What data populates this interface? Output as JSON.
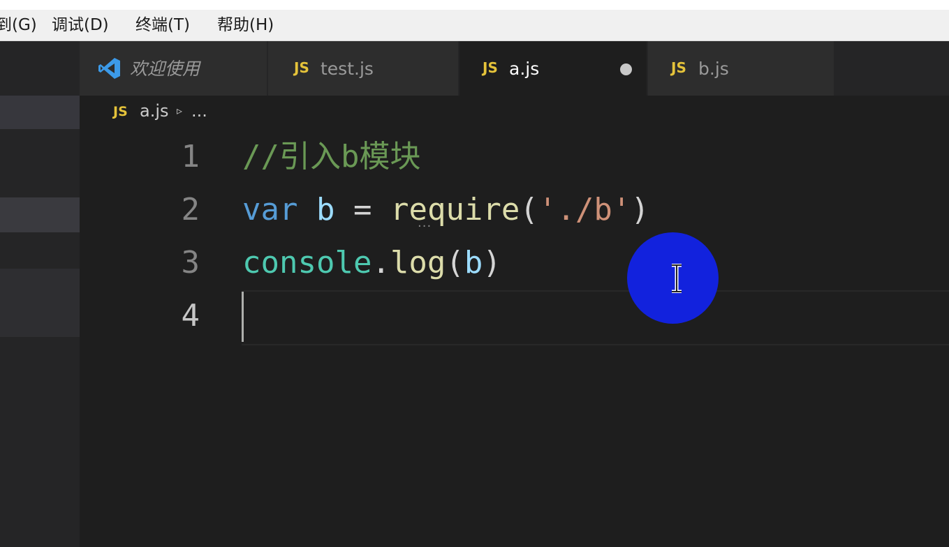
{
  "menu": {
    "items": [
      "到(G)",
      "调试(D)",
      "终端(T)",
      "帮助(H)"
    ]
  },
  "tabs": [
    {
      "label": "欢迎使用",
      "icon": "vscode-icon",
      "active": false
    },
    {
      "label": "test.js",
      "icon": "js-icon",
      "badge": "JS",
      "active": false
    },
    {
      "label": "a.js",
      "icon": "js-icon",
      "badge": "JS",
      "active": true,
      "dirty": true
    },
    {
      "label": "b.js",
      "icon": "js-icon",
      "badge": "JS",
      "active": false
    }
  ],
  "breadcrumb": {
    "badge": "JS",
    "file": "a.js",
    "chevron": "▹",
    "more": "..."
  },
  "editor": {
    "line_numbers": [
      "1",
      "2",
      "3",
      "4"
    ],
    "current_line": 4,
    "lines": [
      {
        "comment": "//引入b模块"
      },
      {
        "kw": "var",
        "sp1": " ",
        "var": "b",
        "eq": " = ",
        "fn": "require",
        "open": "(",
        "str": "'./b'",
        "close": ")"
      },
      {
        "obj": "console",
        "dot": ".",
        "fn": "log",
        "open": "(",
        "var": "b",
        "close": ")"
      },
      {}
    ],
    "hint": "..."
  },
  "colors": {
    "comment": "#6a9955",
    "keyword": "#569cd6",
    "variable": "#9cdcfe",
    "function": "#dcdcaa",
    "string": "#ce9178",
    "object": "#4ec9b0",
    "js_badge": "#e5c33a",
    "click_indicator": "#1222dd"
  }
}
